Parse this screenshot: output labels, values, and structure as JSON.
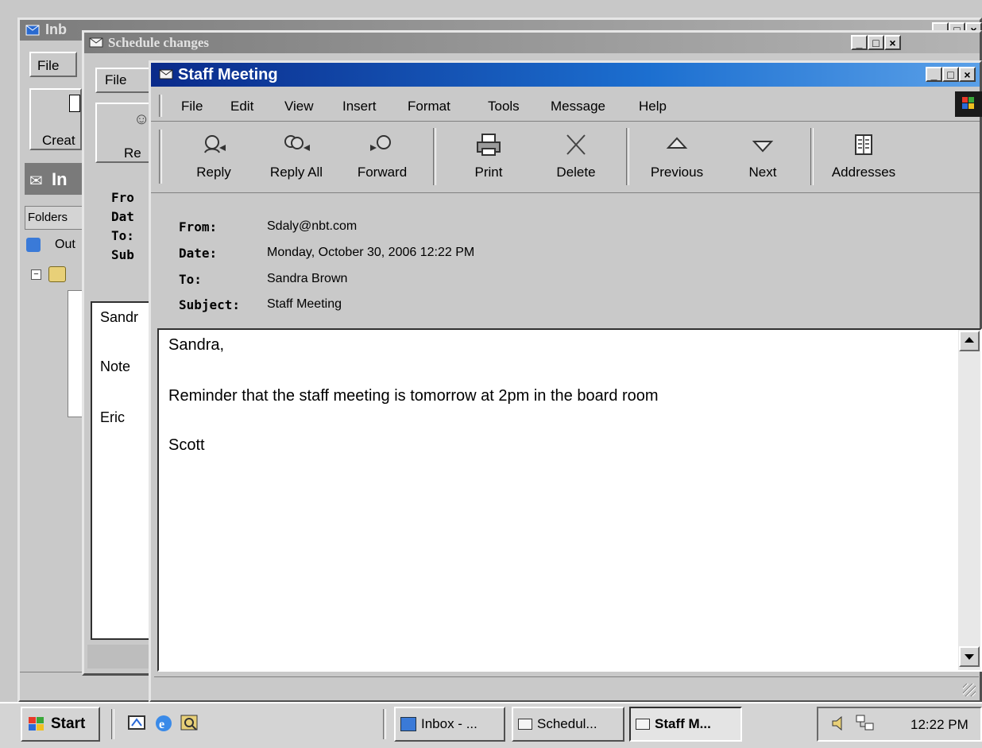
{
  "inbox_window": {
    "title": "Inb",
    "menu_file": "File",
    "create_label": "Creat",
    "panel_title": "In",
    "folders_label": "Folders",
    "tree_item": "Out"
  },
  "schedule_window": {
    "title": "Schedule changes",
    "menu_file": "File",
    "reply_label": "Re",
    "header_labels": [
      "Fro",
      "Dat",
      "To:",
      "Sub"
    ],
    "body_lines": [
      "Sandr",
      "Note ",
      "Eric"
    ]
  },
  "staff_window": {
    "title": "Staff Meeting",
    "menu": [
      "File",
      "Edit",
      "View",
      "Insert",
      "Format",
      "Tools",
      "Message",
      "Help"
    ],
    "toolbar": {
      "reply": "Reply",
      "reply_all": "Reply All",
      "forward": "Forward",
      "print": "Print",
      "delete": "Delete",
      "previous": "Previous",
      "next": "Next",
      "addresses": "Addresses"
    },
    "header": {
      "from_label": "From:",
      "from_value": "Sdaly@nbt.com",
      "date_label": "Date:",
      "date_value": "Monday, October 30, 2006 12:22 PM",
      "to_label": "To:",
      "to_value": "Sandra Brown",
      "subject_label": "Subject:",
      "subject_value": "Staff Meeting"
    },
    "body": {
      "greeting": "Sandra,",
      "message": "Reminder that the staff meeting is tomorrow at 2pm in the board room",
      "signature": "Scott"
    }
  },
  "taskbar": {
    "start_label": "Start",
    "tasks": [
      "Inbox - ...",
      "Schedul...",
      "Staff M..."
    ],
    "clock": "12:22 PM"
  },
  "icons": [
    "outlook-icon",
    "envelope-icon",
    "reply-icon",
    "reply-all-icon",
    "forward-icon",
    "print-icon",
    "delete-icon",
    "previous-icon",
    "next-icon",
    "address-book-icon",
    "windows-logo-icon",
    "speaker-icon",
    "network-icon",
    "desktop-icon",
    "ie-icon",
    "search-icon"
  ],
  "colors": {
    "title_active": "#0a2a8a",
    "title_inactive": "#7c7c7c",
    "window_face": "#c9c9c9"
  }
}
